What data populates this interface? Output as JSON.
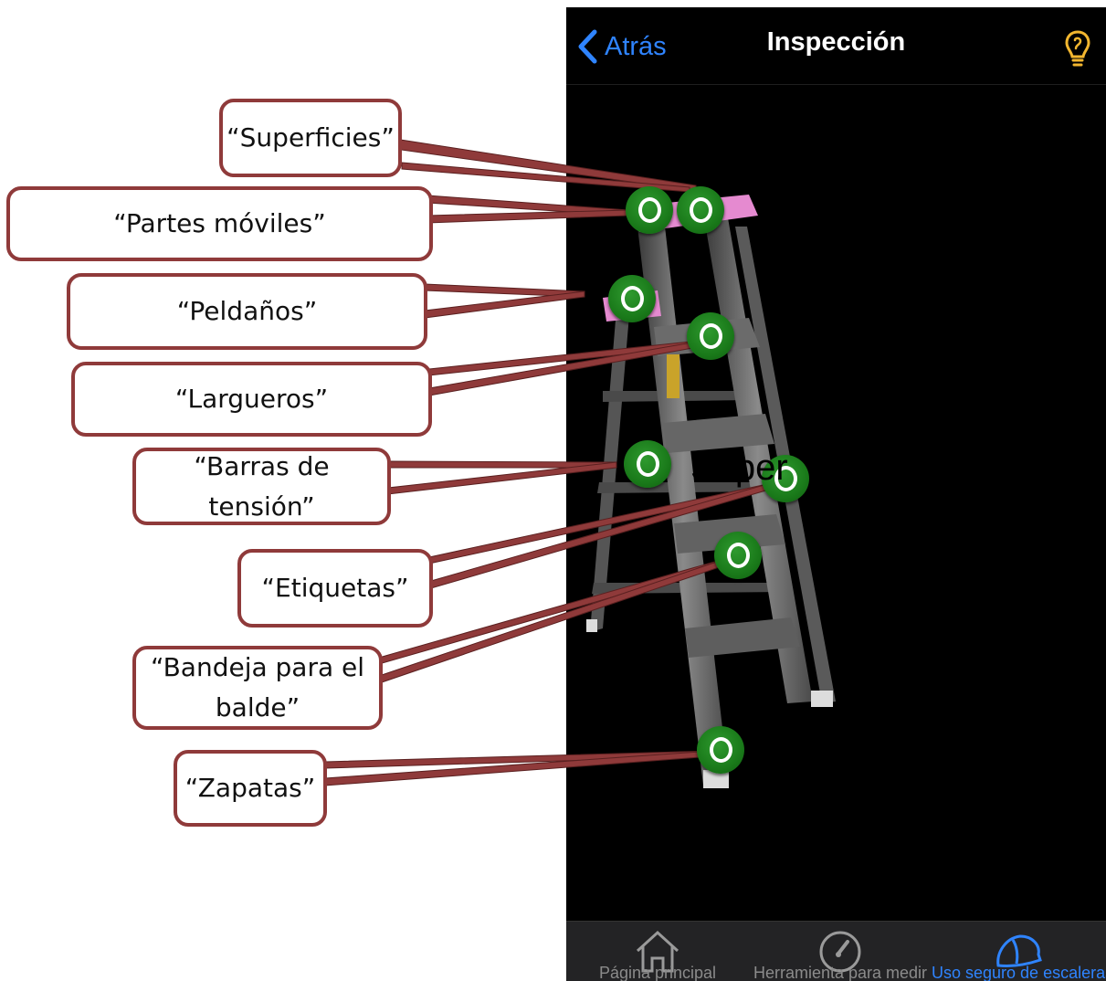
{
  "navbar": {
    "back_label": "Atrás",
    "title": "Inspección",
    "tip_icon": "lightbulb-icon"
  },
  "callouts": {
    "superficies": "“Superficies”",
    "partes_moviles": "“Partes móviles”",
    "peldanos": "“Peldaños”",
    "largueros": "“Largueros”",
    "barras_de_tension": "“Barras de tensión”",
    "etiquetas": "“Etiquetas”",
    "bandeja": "“Bandeja para el balde”",
    "zapatas": "“Zapatas”"
  },
  "floating_text": "Super",
  "tabbar": {
    "items": [
      {
        "label": "Página principal",
        "icon": "home-icon",
        "active": false
      },
      {
        "label": "Herramienta para medir",
        "icon": "gauge-icon",
        "active": false
      },
      {
        "label": "Uso seguro de escaleras",
        "icon": "hard-hat-icon",
        "active": true
      }
    ]
  },
  "colors": {
    "accent": "#2f84ff",
    "callout_border": "#8f3a3a",
    "hotspot_green": "#1a7a1a",
    "ladder_pink": "#e58ad0",
    "bulb": "#f2b62f"
  }
}
